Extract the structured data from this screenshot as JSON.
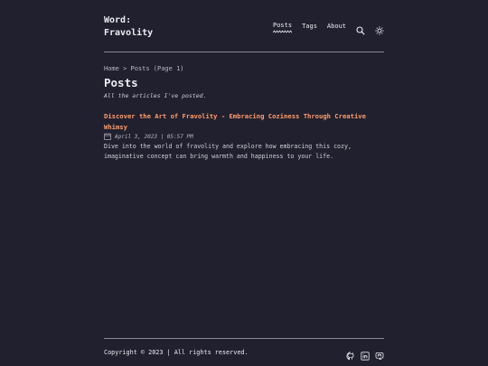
{
  "header": {
    "logo_line1": "Word:",
    "logo_line2": "Fravolity",
    "nav": {
      "posts": "Posts",
      "tags": "Tags",
      "about": "About"
    },
    "icons": [
      "search-icon",
      "theme-toggle-icon"
    ]
  },
  "breadcrumb": "Home > Posts (Page 1)",
  "main": {
    "title": "Posts",
    "description": "All the articles I've posted."
  },
  "posts": [
    {
      "title": "Discover the Art of Fravolity - Embracing Coziness Through Creative Whimsy",
      "date": "April 3, 2023 | 05:57 PM",
      "description": "Dive into the world of fravolity and explore how embracing this cozy, imaginative concept can bring warmth and happiness to your life."
    }
  ],
  "footer": {
    "copyright": "Copyright © 2023 | All rights reserved.",
    "social_icons": [
      "github-icon",
      "linkedin-icon",
      "mastodon-icon"
    ]
  },
  "colors": {
    "background": "#21202e",
    "text": "#eaedf3",
    "accent": "#ff9b6b"
  }
}
